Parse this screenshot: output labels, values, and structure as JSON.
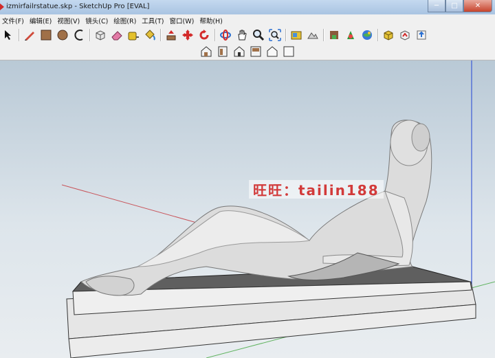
{
  "window": {
    "title": "izmirfailrstatue.skp - SketchUp Pro [EVAL]",
    "minimize_glyph": "─",
    "maximize_glyph": "□",
    "close_glyph": "✕"
  },
  "menu": {
    "items": [
      {
        "label": "文件(F)"
      },
      {
        "label": "编辑(E)"
      },
      {
        "label": "视图(V)"
      },
      {
        "label": "镜头(C)"
      },
      {
        "label": "绘图(R)"
      },
      {
        "label": "工具(T)"
      },
      {
        "label": "窗口(W)"
      },
      {
        "label": "帮助(H)"
      }
    ]
  },
  "toolbar": {
    "icons": [
      "select-arrow-icon",
      "pencil-line-icon",
      "rectangle-icon",
      "circle-icon",
      "arc-icon",
      "make-component-icon",
      "eraser-icon",
      "tape-measure-icon",
      "paint-bucket-icon",
      "push-pull-icon",
      "move-icon",
      "rotate-icon",
      "orbit-icon",
      "pan-icon",
      "zoom-icon",
      "zoom-extents-icon",
      "add-location-icon",
      "toggle-terrain-icon",
      "photo-textures-icon",
      "3d-warehouse-icon",
      "extension-warehouse-icon",
      "google-earth-icon",
      "share-model-icon",
      "upload-icon"
    ]
  },
  "views_toolbar": {
    "icons": [
      "iso-view-icon",
      "top-view-icon",
      "front-view-icon",
      "right-view-icon",
      "back-view-icon",
      "left-view-icon"
    ]
  },
  "viewport": {
    "watermark": "旺旺：tailin188",
    "colors": {
      "sky": "#c0cfdb",
      "ground": "#e8ecef",
      "axis_red": "#c8545a",
      "axis_green": "#5fb35f",
      "axis_blue": "#3b5bd6"
    }
  }
}
